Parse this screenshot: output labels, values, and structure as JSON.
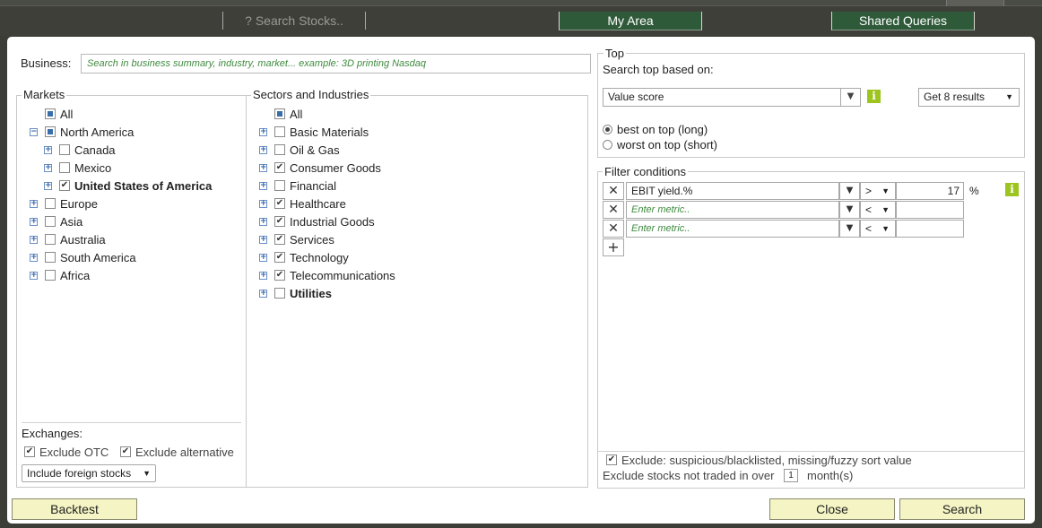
{
  "nav": {
    "search_placeholder": "? Search Stocks..",
    "my_area": "My Area",
    "shared_queries": "Shared Queries"
  },
  "business": {
    "label": "Business:",
    "placeholder": "Search in business summary, industry, market...  example: 3D printing Nasdaq"
  },
  "markets": {
    "title": "Markets",
    "items": [
      {
        "label": "All",
        "state": "partial",
        "expander": "none",
        "bold": false,
        "level": 0
      },
      {
        "label": "North America",
        "state": "partial",
        "expander": "minus",
        "bold": false,
        "level": 0
      },
      {
        "label": "Canada",
        "state": "unchecked",
        "expander": "plus",
        "bold": false,
        "level": 1
      },
      {
        "label": "Mexico",
        "state": "unchecked",
        "expander": "plus",
        "bold": false,
        "level": 1
      },
      {
        "label": "United States of America",
        "state": "checked",
        "expander": "plus",
        "bold": true,
        "level": 1
      },
      {
        "label": "Europe",
        "state": "unchecked",
        "expander": "plus",
        "bold": false,
        "level": 0
      },
      {
        "label": "Asia",
        "state": "unchecked",
        "expander": "plus",
        "bold": false,
        "level": 0
      },
      {
        "label": "Australia",
        "state": "unchecked",
        "expander": "plus",
        "bold": false,
        "level": 0
      },
      {
        "label": "South America",
        "state": "unchecked",
        "expander": "plus",
        "bold": false,
        "level": 0
      },
      {
        "label": "Africa",
        "state": "unchecked",
        "expander": "plus",
        "bold": false,
        "level": 0
      }
    ]
  },
  "exchanges": {
    "label": "Exchanges:",
    "exclude_otc": "Exclude OTC",
    "exclude_alternative": "Exclude alternative",
    "foreign": "Include foreign stocks",
    "foreign_arrow": "▼"
  },
  "sectors": {
    "title": "Sectors and Industries",
    "items": [
      {
        "label": "All",
        "state": "partial",
        "expander": "none",
        "bold": false
      },
      {
        "label": "Basic Materials",
        "state": "unchecked",
        "expander": "plus",
        "bold": false
      },
      {
        "label": "Oil & Gas",
        "state": "unchecked",
        "expander": "plus",
        "bold": false
      },
      {
        "label": "Consumer Goods",
        "state": "checked",
        "expander": "plus",
        "bold": false
      },
      {
        "label": "Financial",
        "state": "unchecked",
        "expander": "plus",
        "bold": false
      },
      {
        "label": "Healthcare",
        "state": "checked",
        "expander": "plus",
        "bold": false
      },
      {
        "label": "Industrial Goods",
        "state": "checked",
        "expander": "plus",
        "bold": false
      },
      {
        "label": "Services",
        "state": "checked",
        "expander": "plus",
        "bold": false
      },
      {
        "label": "Technology",
        "state": "checked",
        "expander": "plus",
        "bold": false
      },
      {
        "label": "Telecommunications",
        "state": "checked",
        "expander": "plus",
        "bold": false
      },
      {
        "label": "Utilities",
        "state": "unchecked",
        "expander": "plus",
        "bold": true
      }
    ]
  },
  "top": {
    "title": "Top",
    "based_on_label": "Search top based on:",
    "score_value": "Value score",
    "results_value": "Get 8 results",
    "best_label": "best on top (long)",
    "worst_label": "worst on top (short)",
    "info": "i"
  },
  "filters": {
    "title": "Filter conditions",
    "rows": [
      {
        "metric": "EBIT yield.%",
        "placeholder": false,
        "op": ">",
        "value": "17",
        "unit": "%"
      },
      {
        "metric": "Enter metric..",
        "placeholder": true,
        "op": "<",
        "value": "",
        "unit": ""
      },
      {
        "metric": "Enter metric..",
        "placeholder": true,
        "op": "<",
        "value": "",
        "unit": ""
      }
    ],
    "add": "+",
    "remove": "✕",
    "info": "i",
    "exclude_label": "Exclude: suspicious/blacklisted, missing/fuzzy sort value",
    "not_traded_prefix": "Exclude stocks not traded in over",
    "not_traded_value": "1",
    "not_traded_suffix": "month(s)"
  },
  "buttons": {
    "backtest": "Backtest",
    "close": "Close",
    "search": "Search"
  },
  "colors": {
    "nav_active": "#2f5a3a",
    "button_bg": "#f4f4c4",
    "info_green": "#9dc41f",
    "placeholder_green": "#3f8b3f"
  }
}
